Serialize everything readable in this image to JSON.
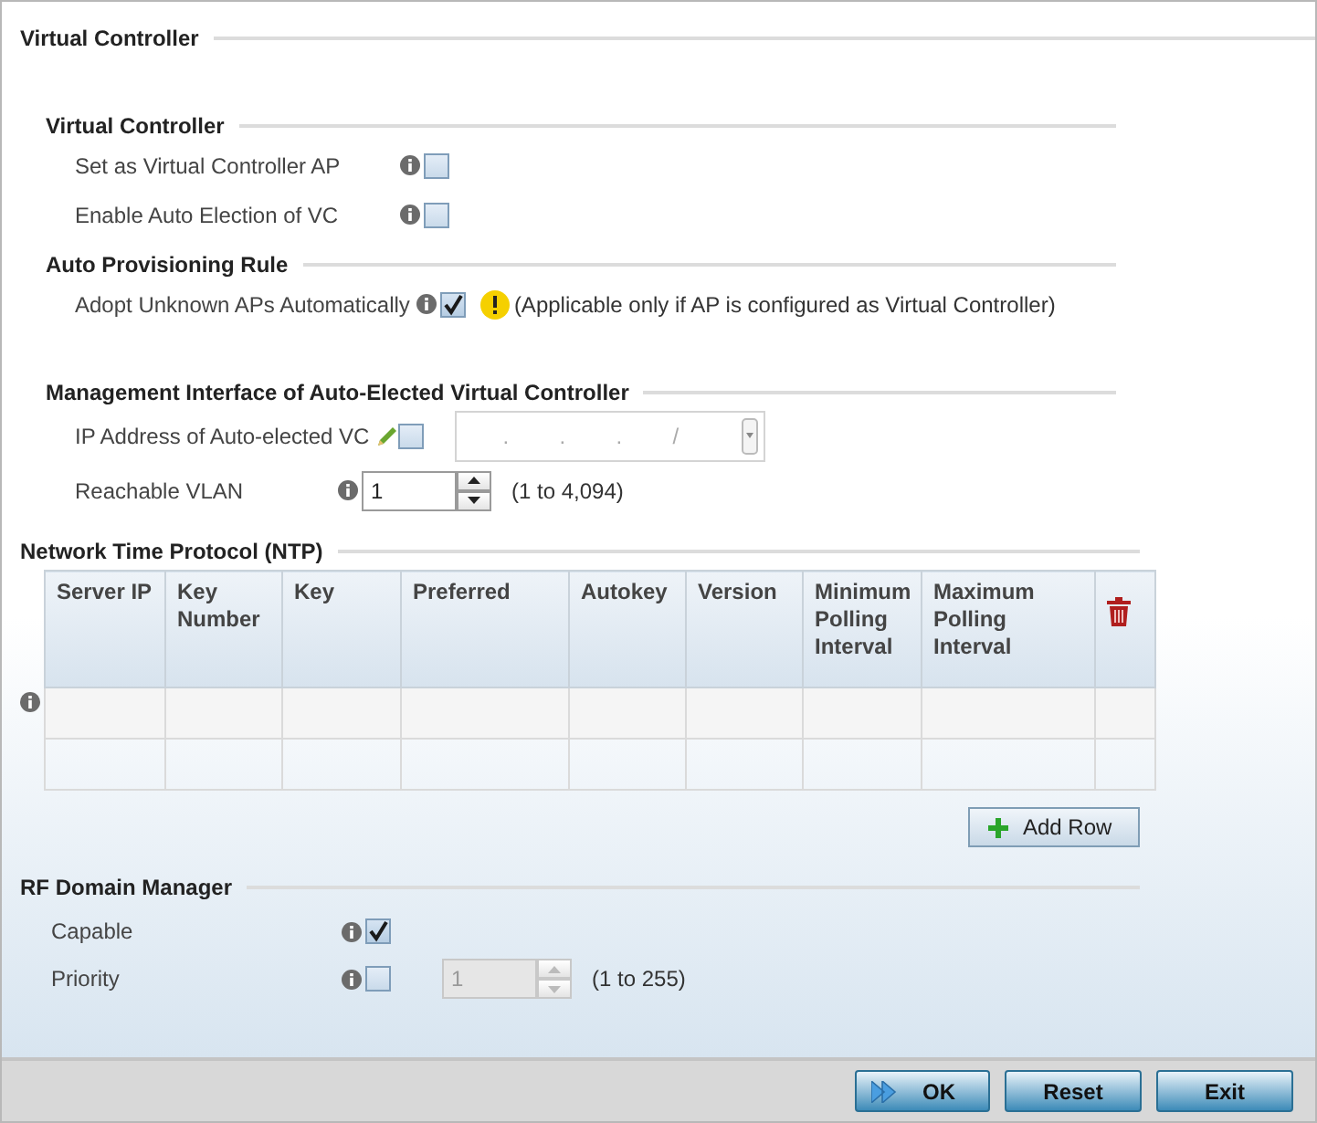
{
  "virtual_controller": {
    "title": "Virtual Controller",
    "groups": [
      {
        "title": "Virtual Controller",
        "rows": [
          {
            "kind": "checkbox",
            "label": "Set as Virtual Controller AP",
            "checked": false
          },
          {
            "kind": "checkbox",
            "label": "Enable Auto Election of VC",
            "checked": false
          }
        ]
      },
      {
        "title": "Auto Provisioning Rule",
        "rows": [
          {
            "kind": "checkbox",
            "label": "Adopt Unknown APs Automatically",
            "checked": true,
            "note": "(Applicable only if AP is configured as Virtual Controller)"
          }
        ]
      },
      {
        "title": "Management Interface of Auto-Elected Virtual Controller",
        "rows": [
          {
            "kind": "ip",
            "label": "IP Address of Auto-elected VC",
            "checked": false,
            "separators": [
              ".",
              ".",
              ".",
              "/"
            ],
            "disabled": true
          },
          {
            "kind": "spinner",
            "label": "Reachable VLAN",
            "value": "1",
            "range": "(1 to 4,094)",
            "disabled": false
          }
        ]
      }
    ]
  },
  "ntp": {
    "title": "Network Time Protocol (NTP)",
    "columns": [
      "Server IP",
      "Key Number",
      "Key",
      "Preferred",
      "Autokey",
      "Version",
      "Minimum Polling Interval",
      "Maximum Polling Interval"
    ],
    "add_button": "Add Row"
  },
  "rf_domain_manager": {
    "title": "RF Domain Manager",
    "rows": [
      {
        "kind": "checkbox",
        "label": "Capable",
        "checked": true
      },
      {
        "kind": "checkbox_spinner",
        "label": "Priority",
        "checked": false,
        "value": "1",
        "range": "(1 to 255)",
        "disabled": true
      }
    ]
  },
  "buttons": [
    {
      "label": "OK",
      "kind": "ok"
    },
    {
      "label": "Reset",
      "kind": "plain"
    },
    {
      "label": "Exit",
      "kind": "plain"
    }
  ]
}
